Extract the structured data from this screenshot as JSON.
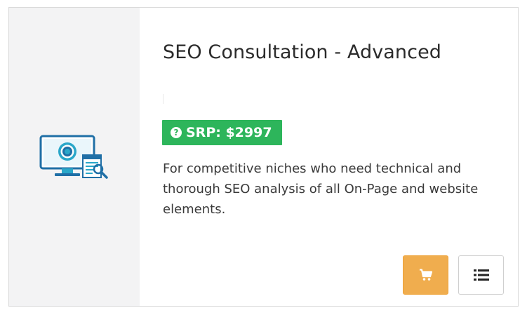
{
  "product": {
    "title": "SEO Consultation - Advanced",
    "price_badge": {
      "icon": "question-circle-icon",
      "label": "SRP: $2997",
      "color": "#2db55b"
    },
    "description": "For competitive niches who need technical and thorough SEO analysis of all On-Page and website elements.",
    "media_icon": "monitor-with-target-and-magnifier-icon"
  },
  "actions": {
    "cart_icon": "shopping-cart-icon",
    "cart_color": "#f0ad4e",
    "details_icon": "list-icon"
  }
}
